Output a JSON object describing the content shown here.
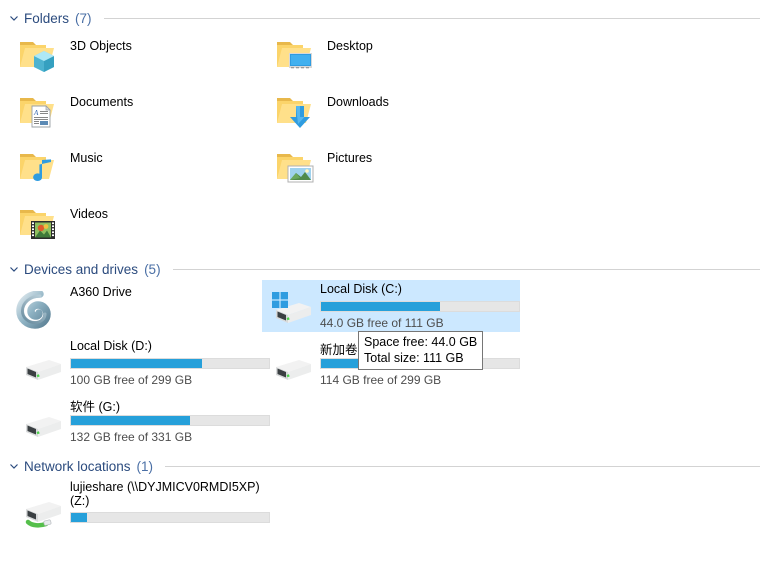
{
  "sections": {
    "folders": {
      "title": "Folders",
      "count": "(7)",
      "chevron": "chevron-down-icon"
    },
    "devices": {
      "title": "Devices and drives",
      "count": "(5)",
      "chevron": "chevron-down-icon"
    },
    "network": {
      "title": "Network locations",
      "count": "(1)",
      "chevron": "chevron-down-icon"
    }
  },
  "folders": [
    {
      "label": "3D Objects",
      "icon": "folder-3d-objects-icon"
    },
    {
      "label": "Desktop",
      "icon": "folder-desktop-icon"
    },
    {
      "label": "Documents",
      "icon": "folder-documents-icon"
    },
    {
      "label": "Downloads",
      "icon": "folder-downloads-icon"
    },
    {
      "label": "Music",
      "icon": "folder-music-icon"
    },
    {
      "label": "Pictures",
      "icon": "folder-pictures-icon"
    },
    {
      "label": "Videos",
      "icon": "folder-videos-icon"
    }
  ],
  "drives": [
    {
      "name": "A360 Drive",
      "icon": "a360-drive-icon",
      "has_bar": false,
      "sub": "",
      "selected": false
    },
    {
      "name": "Local Disk (C:)",
      "icon": "windows-drive-icon",
      "has_bar": true,
      "fill_percent": 60,
      "sub": "44.0 GB free of 111 GB",
      "selected": true
    },
    {
      "name": "Local Disk (D:)",
      "icon": "hard-drive-icon",
      "has_bar": true,
      "fill_percent": 66,
      "sub": "100 GB free of 299 GB",
      "selected": false
    },
    {
      "name": "新加卷",
      "icon": "hard-drive-icon",
      "has_bar": true,
      "fill_percent": 62,
      "sub": "114 GB free of 299 GB",
      "selected": false
    },
    {
      "name": "软件 (G:)",
      "icon": "hard-drive-icon",
      "has_bar": true,
      "fill_percent": 60,
      "sub": "132 GB free of 331 GB",
      "selected": false
    }
  ],
  "network_drives": [
    {
      "name": "lujieshare (\\\\DYJMICV0RMDI5XP) (Z:)",
      "icon": "network-drive-icon",
      "fill_percent": 8
    }
  ],
  "tooltip": {
    "line1": "Space free: 44.0 GB",
    "line2": "Total size: 111 GB"
  },
  "colors": {
    "accent_bar": "#26a0da",
    "selection": "#cce8ff",
    "header_text": "#2b4b7e",
    "folder_body": "#fbd46a"
  }
}
